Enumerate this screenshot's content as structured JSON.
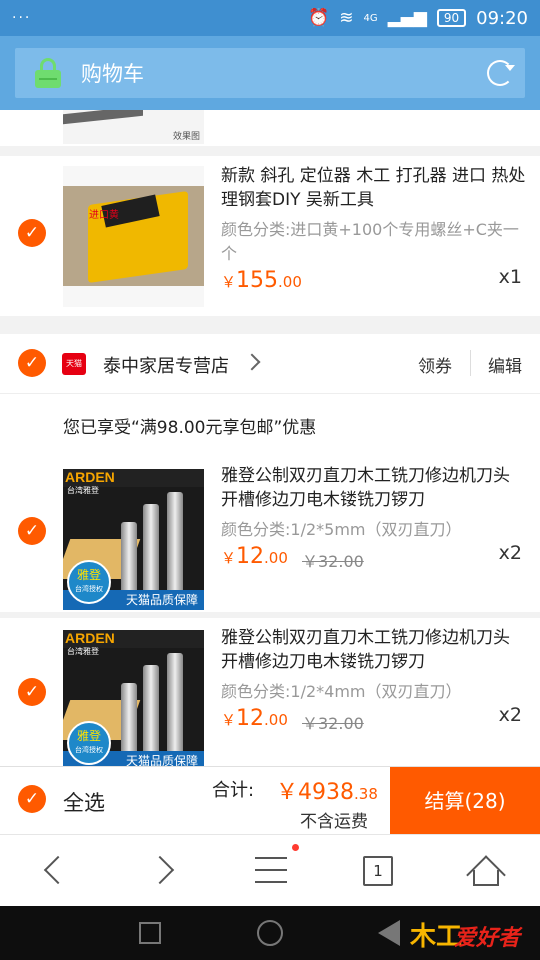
{
  "status_bar": {
    "dots": "···",
    "network": "4G",
    "battery": "90",
    "time": "09:20"
  },
  "header": {
    "title": "购物车"
  },
  "partial_item": {
    "caption": "效果图"
  },
  "items": [
    {
      "title": "新款 斜孔 定位器 木工 打孔器 进口 热处理钢套DIY 吴新工具",
      "variant": "颜色分类:进口黄+100个专用螺丝+C夹一个",
      "currency": "￥",
      "price_main": "155",
      "price_cents": ".00",
      "quantity": "x1",
      "thumb_label": "进口黄"
    },
    {
      "title": "雅登公制双刃直刀木工铣刀修边机刀头开槽修边刀电木镂铣刀锣刀",
      "variant": "颜色分类:1/2*5mm（双刃直刀）",
      "currency": "￥",
      "price_main": "12",
      "price_cents": ".00",
      "original_price": "￥32.00",
      "quantity": "x2",
      "thumb_brand": "ARDEN",
      "thumb_sub": "台湾雅登",
      "thumb_seal": "雅登",
      "thumb_seal_sub": "台湾授权",
      "thumb_banner": "天猫品质保障"
    },
    {
      "title": "雅登公制双刃直刀木工铣刀修边机刀头开槽修边刀电木镂铣刀锣刀",
      "variant": "颜色分类:1/2*4mm（双刃直刀）",
      "currency": "￥",
      "price_main": "12",
      "price_cents": ".00",
      "original_price": "￥32.00",
      "quantity": "x2",
      "thumb_brand": "ARDEN",
      "thumb_sub": "台湾雅登",
      "thumb_seal": "雅登",
      "thumb_seal_sub": "台湾授权",
      "thumb_banner": "天猫品质保障"
    }
  ],
  "shop": {
    "icon_text": "天猫",
    "name": "泰中家居专营店",
    "coupon": "领券",
    "edit": "编辑",
    "promo": "您已享受“满98.00元享包邮”优惠"
  },
  "checkout": {
    "select_all": "全选",
    "total_label": "合计:",
    "total_currency": "￥",
    "total_main": "4938",
    "total_cents": ".38",
    "shipping_note": "不含运费",
    "pay_button": "结算(28)"
  },
  "browser_nav": {
    "tabs_count": "1"
  },
  "watermark": {
    "text": "爱好者",
    "mark": "木工"
  },
  "colors": {
    "accent": "#ff5a00",
    "header": "#5fa8e0",
    "status": "#3f8fd0"
  }
}
